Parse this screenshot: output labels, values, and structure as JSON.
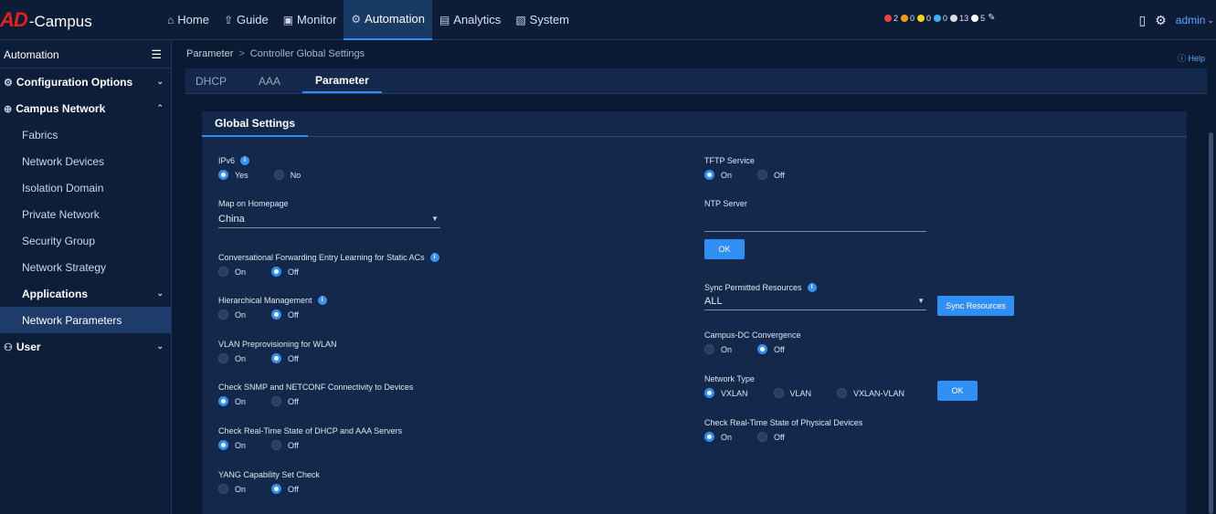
{
  "app": {
    "brand": "AD",
    "brand_rest": "-Campus"
  },
  "nav": [
    {
      "label": "Home",
      "icon": "home-icon",
      "glyph": "⌂"
    },
    {
      "label": "Guide",
      "icon": "signpost-icon",
      "glyph": "⇧"
    },
    {
      "label": "Monitor",
      "icon": "monitor-icon",
      "glyph": "▣"
    },
    {
      "label": "Automation",
      "icon": "automation-icon",
      "glyph": "⚙"
    },
    {
      "label": "Analytics",
      "icon": "analytics-icon",
      "glyph": "▤"
    },
    {
      "label": "System",
      "icon": "system-icon",
      "glyph": "▧"
    }
  ],
  "alarms": [
    {
      "count": "2",
      "color": "#e8453c"
    },
    {
      "count": "0",
      "color": "#f39a1e"
    },
    {
      "count": "0",
      "color": "#f2d21a"
    },
    {
      "count": "0",
      "color": "#3fb3f2"
    },
    {
      "count": "13",
      "color": "#d6dce6"
    },
    {
      "count": "5",
      "color": "#ffffff"
    }
  ],
  "user": {
    "name": "admin"
  },
  "sidebar": {
    "title": "Automation",
    "items": [
      {
        "label": "Configuration Options"
      },
      {
        "label": "Campus Network"
      },
      {
        "label": "Fabrics"
      },
      {
        "label": "Network Devices"
      },
      {
        "label": "Isolation Domain"
      },
      {
        "label": "Private Network"
      },
      {
        "label": "Security Group"
      },
      {
        "label": "Network Strategy"
      },
      {
        "label": "Applications"
      },
      {
        "label": "Network Parameters"
      },
      {
        "label": "User"
      }
    ]
  },
  "breadcrumb": {
    "root": "Parameter",
    "current": "Controller Global Settings"
  },
  "help": "Help",
  "tabs": [
    "DHCP",
    "AAA",
    "Parameter"
  ],
  "panel_title": "Global Settings",
  "left": {
    "ipv6": {
      "label": "IPv6",
      "opt1": "Yes",
      "opt2": "No",
      "selected": "Yes"
    },
    "map": {
      "label": "Map on Homepage",
      "value": "China"
    },
    "cfe": {
      "label": "Conversational Forwarding Entry Learning for Static ACs",
      "opt1": "On",
      "opt2": "Off",
      "selected": "Off"
    },
    "hier": {
      "label": "Hierarchical Management",
      "opt1": "On",
      "opt2": "Off",
      "selected": "Off"
    },
    "vlan": {
      "label": "VLAN Preprovisioning for WLAN",
      "opt1": "On",
      "opt2": "Off",
      "selected": "Off"
    },
    "snmp": {
      "label": "Check SNMP and NETCONF Connectivity to Devices",
      "opt1": "On",
      "opt2": "Off",
      "selected": "On"
    },
    "dhcp": {
      "label": "Check Real-Time State of DHCP and AAA Servers",
      "opt1": "On",
      "opt2": "Off",
      "selected": "On"
    },
    "yang": {
      "label": "YANG Capability Set Check",
      "opt1": "On",
      "opt2": "Off",
      "selected": "Off"
    }
  },
  "right": {
    "tftp": {
      "label": "TFTP Service",
      "opt1": "On",
      "opt2": "Off",
      "selected": "On"
    },
    "ntp": {
      "label": "NTP Server",
      "value": ""
    },
    "ok1": "OK",
    "sync": {
      "label": "Sync Permitted Resources",
      "value": "ALL",
      "button": "Sync Resources"
    },
    "cdc": {
      "label": "Campus-DC Convergence",
      "opt1": "On",
      "opt2": "Off",
      "selected": "Off"
    },
    "ntype": {
      "label": "Network Type",
      "opt1": "VXLAN",
      "opt2": "VLAN",
      "opt3": "VXLAN-VLAN",
      "selected": "VXLAN"
    },
    "ok2": "OK",
    "phys": {
      "label": "Check Real-Time State of Physical Devices",
      "opt1": "On",
      "opt2": "Off",
      "selected": "On"
    }
  }
}
